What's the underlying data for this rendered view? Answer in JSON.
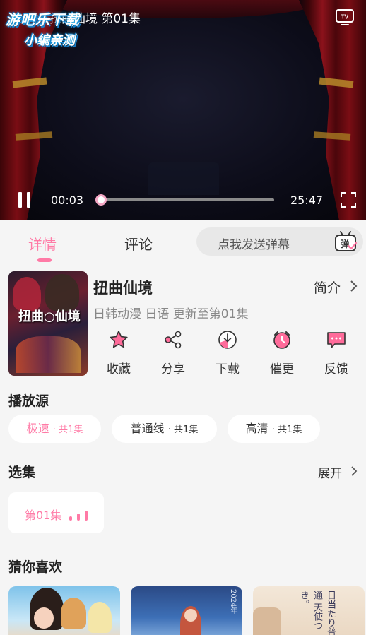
{
  "player": {
    "title": "扭曲仙境 第01集",
    "watermark_line1": "游吧乐下载",
    "watermark_line2": "小编亲测",
    "current_time": "00:03",
    "total_time": "25:47",
    "progress": 0.002
  },
  "tabs": [
    {
      "label": "详情",
      "active": true
    },
    {
      "label": "评论",
      "active": false
    }
  ],
  "danmu": {
    "placeholder": "点我发送弹幕",
    "icon_text": "弹"
  },
  "anime": {
    "title": "扭曲仙境",
    "intro_label": "简介",
    "meta": "日韩动漫 日语 更新至第01集",
    "cover_title": "扭曲○仙境"
  },
  "actions": [
    {
      "label": "收藏",
      "icon": "star-icon"
    },
    {
      "label": "分享",
      "icon": "share-icon"
    },
    {
      "label": "下载",
      "icon": "download-icon"
    },
    {
      "label": "催更",
      "icon": "alarm-clock-icon"
    },
    {
      "label": "反馈",
      "icon": "feedback-icon"
    }
  ],
  "sources": {
    "title": "播放源",
    "items": [
      {
        "name": "极速",
        "count": "· 共1集",
        "active": true
      },
      {
        "name": "普通线",
        "count": "· 共1集",
        "active": false
      },
      {
        "name": "高清",
        "count": "· 共1集",
        "active": false
      }
    ]
  },
  "episodes": {
    "title": "选集",
    "expand_label": "展开",
    "items": [
      {
        "label": "第01集",
        "playing": true
      }
    ]
  },
  "recommend": {
    "title": "猜你喜欢",
    "items": [
      {
        "caption": ""
      },
      {
        "caption": "2024年"
      },
      {
        "caption": "日当たり普通 天使つき。"
      }
    ]
  },
  "colors": {
    "accent": "#ff7aa6",
    "background": "#f5f5f5",
    "card": "#ffffff"
  }
}
